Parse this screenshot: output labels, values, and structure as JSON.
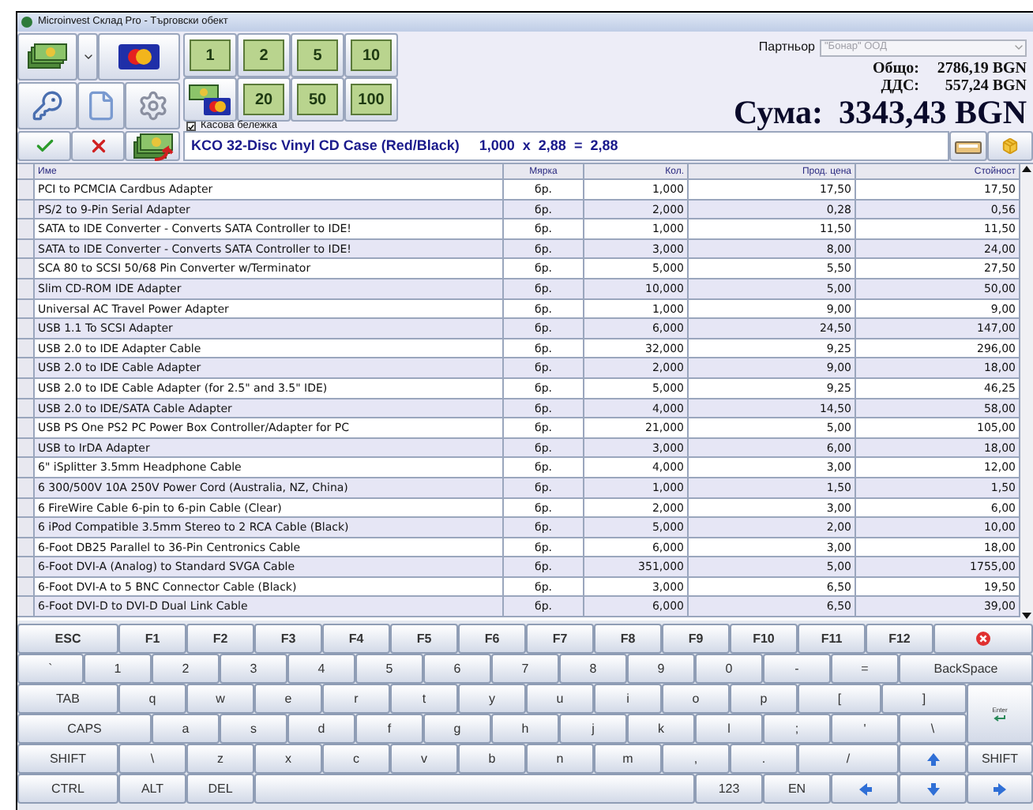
{
  "window": {
    "title": "Microinvest Склад Pro - Търговски обект"
  },
  "denominations": [
    "1",
    "2",
    "5",
    "10",
    "20",
    "50",
    "100"
  ],
  "receipt_checkbox": {
    "label": "Касова бележка",
    "checked": true
  },
  "item_line": "KCO 32-Disc Vinyl CD Case (Red/Black)     1,000  x  2,88  =  2,88",
  "partner": {
    "label": "Партньор",
    "value": "\"Бонар\" ООД",
    "disabled": true
  },
  "totals": [
    {
      "label": "Общо:",
      "value": "2786,19 BGN"
    },
    {
      "label": "ДДС:",
      "value": "557,24 BGN"
    }
  ],
  "grand_total": {
    "label": "Сума:",
    "value": "3343,43 BGN"
  },
  "table": {
    "columns": [
      "Име",
      "Мярка",
      "Кол.",
      "Прод. цена",
      "Стойност"
    ],
    "rows": [
      [
        "PCI to PCMCIA Cardbus Adapter",
        "бр.",
        "1,000",
        "17,50",
        "17,50"
      ],
      [
        "PS/2 to 9-Pin Serial Adapter",
        "бр.",
        "2,000",
        "0,28",
        "0,56"
      ],
      [
        "SATA to IDE Converter - Converts SATA Controller to IDE!",
        "бр.",
        "1,000",
        "11,50",
        "11,50"
      ],
      [
        "SATA to IDE Converter - Converts SATA Controller to IDE!",
        "бр.",
        "3,000",
        "8,00",
        "24,00"
      ],
      [
        "SCA 80 to SCSI 50/68 Pin Converter w/Terminator",
        "бр.",
        "5,000",
        "5,50",
        "27,50"
      ],
      [
        "Slim CD-ROM IDE Adapter",
        "бр.",
        "10,000",
        "5,00",
        "50,00"
      ],
      [
        "Universal AC Travel Power Adapter",
        "бр.",
        "1,000",
        "9,00",
        "9,00"
      ],
      [
        "USB 1.1 To SCSI Adapter",
        "бр.",
        "6,000",
        "24,50",
        "147,00"
      ],
      [
        "USB 2.0 to IDE Adapter Cable",
        "бр.",
        "32,000",
        "9,25",
        "296,00"
      ],
      [
        "USB 2.0 to IDE Cable Adapter",
        "бр.",
        "2,000",
        "9,00",
        "18,00"
      ],
      [
        "USB 2.0 to IDE Cable Adapter (for 2.5\" and 3.5\" IDE)",
        "бр.",
        "5,000",
        "9,25",
        "46,25"
      ],
      [
        "USB 2.0 to IDE/SATA Cable Adapter",
        "бр.",
        "4,000",
        "14,50",
        "58,00"
      ],
      [
        "USB PS One PS2 PC Power Box Controller/Adapter for PC",
        "бр.",
        "21,000",
        "5,00",
        "105,00"
      ],
      [
        "USB to IrDA Adapter",
        "бр.",
        "3,000",
        "6,00",
        "18,00"
      ],
      [
        "6\" iSplitter 3.5mm Headphone Cable",
        "бр.",
        "4,000",
        "3,00",
        "12,00"
      ],
      [
        "6 300/500V 10A 250V Power Cord (Australia, NZ, China)",
        "бр.",
        "1,000",
        "1,50",
        "1,50"
      ],
      [
        "6 FireWire Cable 6-pin to 6-pin Cable (Clear)",
        "бр.",
        "2,000",
        "3,00",
        "6,00"
      ],
      [
        "6 iPod Compatible 3.5mm Stereo to 2 RCA Cable (Black)",
        "бр.",
        "5,000",
        "2,00",
        "10,00"
      ],
      [
        "6-Foot DB25 Parallel to 36-Pin Centronics Cable",
        "бр.",
        "6,000",
        "3,00",
        "18,00"
      ],
      [
        "6-Foot DVI-A (Analog) to Standard SVGA Cable",
        "бр.",
        "351,000",
        "5,00",
        "1755,00"
      ],
      [
        "6-Foot DVI-A to 5 BNC Connector Cable (Black)",
        "бр.",
        "3,000",
        "6,50",
        "19,50"
      ],
      [
        "6-Foot DVI-D to DVI-D Dual Link Cable",
        "бр.",
        "6,000",
        "6,50",
        "39,00"
      ]
    ]
  },
  "keyboard": {
    "rows": [
      [
        {
          "kind": "fn",
          "label": "ESC"
        },
        {
          "kind": "fn",
          "label": "F1"
        },
        {
          "kind": "fn",
          "label": "F2"
        },
        {
          "kind": "fn",
          "label": "F3"
        },
        {
          "kind": "fn",
          "label": "F4"
        },
        {
          "kind": "fn",
          "label": "F5"
        },
        {
          "kind": "fn",
          "label": "F6"
        },
        {
          "kind": "fn",
          "label": "F7"
        },
        {
          "kind": "fn",
          "label": "F8"
        },
        {
          "kind": "fn",
          "label": "F9"
        },
        {
          "kind": "fn",
          "label": "F10"
        },
        {
          "kind": "fn",
          "label": "F11"
        },
        {
          "kind": "fn",
          "label": "F12"
        },
        {
          "kind": "close"
        }
      ],
      [
        {
          "kind": "key",
          "label": "`"
        },
        {
          "kind": "key",
          "label": "1"
        },
        {
          "kind": "key",
          "label": "2"
        },
        {
          "kind": "key",
          "label": "3"
        },
        {
          "kind": "key",
          "label": "4"
        },
        {
          "kind": "key",
          "label": "5"
        },
        {
          "kind": "key",
          "label": "6"
        },
        {
          "kind": "key",
          "label": "7"
        },
        {
          "kind": "key",
          "label": "8"
        },
        {
          "kind": "key",
          "label": "9"
        },
        {
          "kind": "key",
          "label": "0"
        },
        {
          "kind": "key",
          "label": "-"
        },
        {
          "kind": "key",
          "label": "="
        },
        {
          "kind": "key",
          "label": "BackSpace"
        }
      ],
      [
        {
          "kind": "key",
          "label": "TAB"
        },
        {
          "kind": "key",
          "label": "q"
        },
        {
          "kind": "key",
          "label": "w"
        },
        {
          "kind": "key",
          "label": "e"
        },
        {
          "kind": "key",
          "label": "r"
        },
        {
          "kind": "key",
          "label": "t"
        },
        {
          "kind": "key",
          "label": "y"
        },
        {
          "kind": "key",
          "label": "u"
        },
        {
          "kind": "key",
          "label": "i"
        },
        {
          "kind": "key",
          "label": "o"
        },
        {
          "kind": "key",
          "label": "p"
        },
        {
          "kind": "key",
          "label": "["
        },
        {
          "kind": "key",
          "label": "]"
        },
        {
          "kind": "enter",
          "label": "Enter"
        }
      ],
      [
        {
          "kind": "key",
          "label": "CAPS"
        },
        {
          "kind": "key",
          "label": "a"
        },
        {
          "kind": "key",
          "label": "s"
        },
        {
          "kind": "key",
          "label": "d"
        },
        {
          "kind": "key",
          "label": "f"
        },
        {
          "kind": "key",
          "label": "g"
        },
        {
          "kind": "key",
          "label": "h"
        },
        {
          "kind": "key",
          "label": "j"
        },
        {
          "kind": "key",
          "label": "k"
        },
        {
          "kind": "key",
          "label": "l"
        },
        {
          "kind": "key",
          "label": ";"
        },
        {
          "kind": "key",
          "label": "'"
        },
        {
          "kind": "key",
          "label": "\\"
        }
      ],
      [
        {
          "kind": "key",
          "label": "SHIFT"
        },
        {
          "kind": "key",
          "label": "\\"
        },
        {
          "kind": "key",
          "label": "z"
        },
        {
          "kind": "key",
          "label": "x"
        },
        {
          "kind": "key",
          "label": "c"
        },
        {
          "kind": "key",
          "label": "v"
        },
        {
          "kind": "key",
          "label": "b"
        },
        {
          "kind": "key",
          "label": "n"
        },
        {
          "kind": "key",
          "label": "m"
        },
        {
          "kind": "key",
          "label": ","
        },
        {
          "kind": "key",
          "label": "."
        },
        {
          "kind": "key",
          "label": "/"
        },
        {
          "kind": "up"
        },
        {
          "kind": "key",
          "label": "SHIFT"
        }
      ],
      [
        {
          "kind": "key",
          "label": "CTRL"
        },
        {
          "kind": "key",
          "label": "ALT"
        },
        {
          "kind": "key",
          "label": "DEL"
        },
        {
          "kind": "space"
        },
        {
          "kind": "key",
          "label": "123"
        },
        {
          "kind": "key",
          "label": "EN"
        },
        {
          "kind": "left"
        },
        {
          "kind": "down"
        },
        {
          "kind": "right"
        }
      ]
    ]
  }
}
